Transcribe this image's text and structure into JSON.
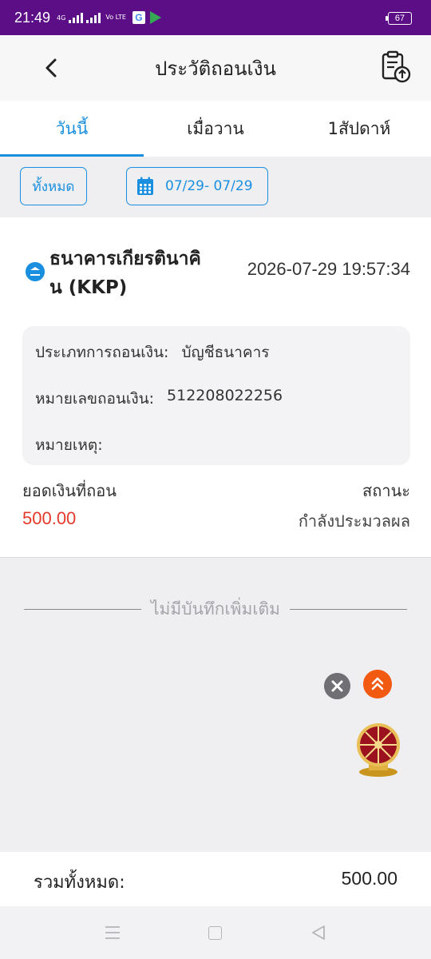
{
  "status_bar": {
    "time": "21:49",
    "network_label": "4G",
    "volte_label": "Vo LTE",
    "battery": "67"
  },
  "header": {
    "title": "ประวัติถอนเงิน",
    "back_icon": "chevron-left-icon",
    "export_icon": "clipboard-upload-icon"
  },
  "tabs": [
    {
      "label": "วันนี้",
      "active": true
    },
    {
      "label": "เมื่อวาน",
      "active": false
    },
    {
      "label": "1สัปดาห์",
      "active": false
    }
  ],
  "filters": {
    "all_label": "ทั้งหมด",
    "date_range": "07/29- 07/29",
    "date_icon": "calendar-icon"
  },
  "record": {
    "bank_name": "ธนาคารเกียรตินาคิน (KKP)",
    "time": "2026-07-29 19:57:34",
    "details": {
      "type_label": "ประเภทการถอนเงิน:",
      "type_value": "บัญชีธนาคาร",
      "number_label": "หมายเลขถอนเงิน:",
      "number_value": "512208022256",
      "note_label": "หมายเหตุ:",
      "note_value": ""
    },
    "amount_label": "ยอดเงินที่ถอน",
    "amount_value": "500.00",
    "status_label": "สถานะ",
    "status_value": "กำลังประมวลผล"
  },
  "no_more_text": "ไม่มีบันทึกเพิ่มเติม",
  "total": {
    "label": "รวมทั้งหมด:",
    "value": "500.00"
  },
  "colors": {
    "accent": "#1a8fe0",
    "amount": "#e53a2a",
    "status_bar": "#5b0e86",
    "scroll_top": "#f25a12"
  }
}
